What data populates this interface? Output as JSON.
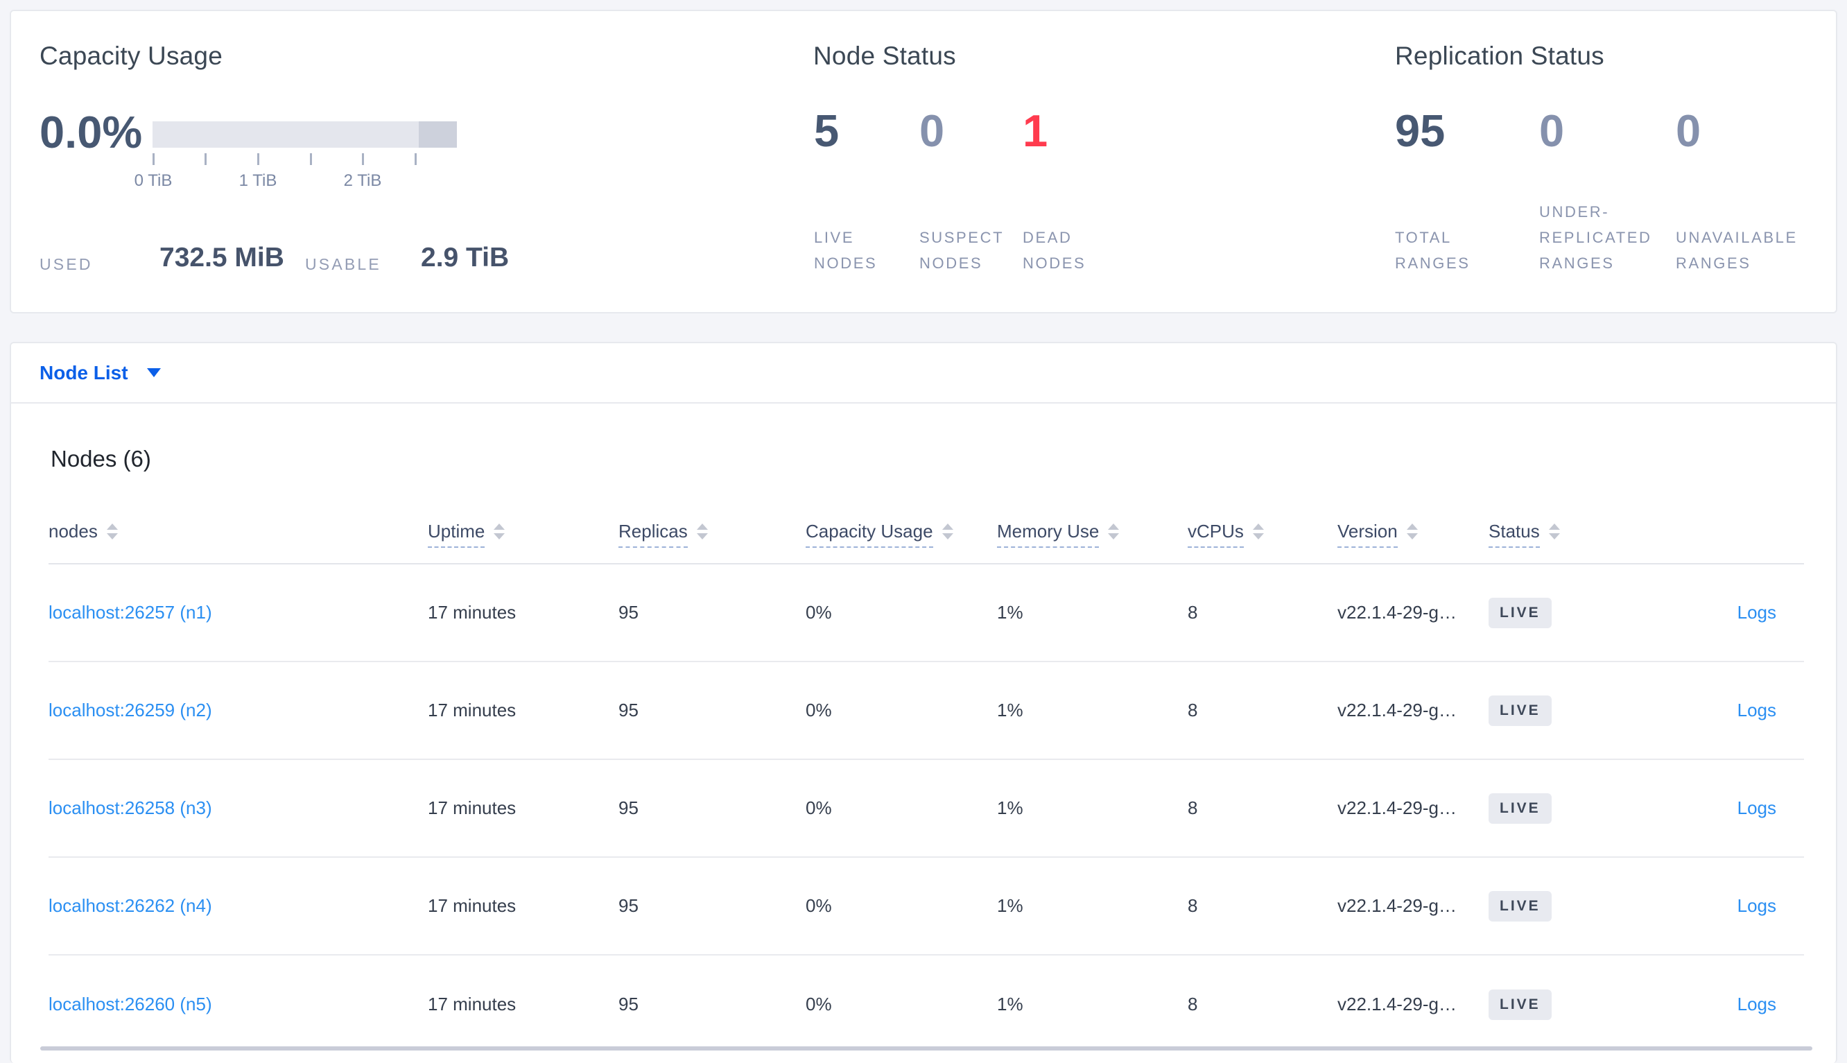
{
  "colors": {
    "accent_blue": "#0b5fe8",
    "link_blue": "#2b8ff2",
    "dead_red": "#ff3b4e",
    "stat_dark": "#475872",
    "stat_muted": "#8591ad"
  },
  "summary": {
    "capacity": {
      "title": "Capacity Usage",
      "percent": "0.0%",
      "ticks": [
        "0 TiB",
        "1 TiB",
        "2 TiB"
      ],
      "used_label": "USED",
      "used_value": "732.5 MiB",
      "usable_label": "USABLE",
      "usable_value": "2.9 TiB"
    },
    "node_status": {
      "title": "Node Status",
      "stats": [
        {
          "value": "5",
          "label": "LIVE\nNODES"
        },
        {
          "value": "0",
          "label": "SUSPECT\nNODES"
        },
        {
          "value": "1",
          "label": "DEAD\nNODES"
        }
      ]
    },
    "replication": {
      "title": "Replication Status",
      "stats": [
        {
          "value": "95",
          "label": "TOTAL\nRANGES"
        },
        {
          "value": "0",
          "label": "UNDER-\nREPLICATED\nRANGES"
        },
        {
          "value": "0",
          "label": "UNAVAILABLE\nRANGES"
        }
      ]
    }
  },
  "node_list": {
    "label": "Node List"
  },
  "table": {
    "title": "Nodes (6)",
    "columns": [
      "nodes",
      "Uptime",
      "Replicas",
      "Capacity Usage",
      "Memory Use",
      "vCPUs",
      "Version",
      "Status"
    ],
    "logs_label": "Logs",
    "rows": [
      {
        "node": "localhost:26257 (n1)",
        "uptime": "17 minutes",
        "replicas": "95",
        "capacity": "0%",
        "memory": "1%",
        "vcpus": "8",
        "version": "v22.1.4-29-g…",
        "status": "LIVE"
      },
      {
        "node": "localhost:26259 (n2)",
        "uptime": "17 minutes",
        "replicas": "95",
        "capacity": "0%",
        "memory": "1%",
        "vcpus": "8",
        "version": "v22.1.4-29-g…",
        "status": "LIVE"
      },
      {
        "node": "localhost:26258 (n3)",
        "uptime": "17 minutes",
        "replicas": "95",
        "capacity": "0%",
        "memory": "1%",
        "vcpus": "8",
        "version": "v22.1.4-29-g…",
        "status": "LIVE"
      },
      {
        "node": "localhost:26262 (n4)",
        "uptime": "17 minutes",
        "replicas": "95",
        "capacity": "0%",
        "memory": "1%",
        "vcpus": "8",
        "version": "v22.1.4-29-g…",
        "status": "LIVE"
      },
      {
        "node": "localhost:26260 (n5)",
        "uptime": "17 minutes",
        "replicas": "95",
        "capacity": "0%",
        "memory": "1%",
        "vcpus": "8",
        "version": "v22.1.4-29-g…",
        "status": "LIVE"
      }
    ]
  }
}
